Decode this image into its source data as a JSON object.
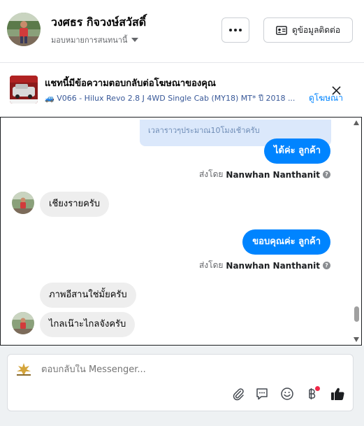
{
  "header": {
    "page_name": "วงศธร กิจวงษ์สวัสดิ์",
    "subtitle": "มอบหมายการสนทนานี้",
    "contact_button": "ดูข้อมูลติดต่อ"
  },
  "ad": {
    "title": "แชทนี้มีข้อความตอบกลับต่อโฆษณาของคุณ",
    "description": "🚙 V066 - Hilux Revo 2.8 J 4WD Single Cab (MY18) MT* ปี 2018 ...",
    "link": "ดูโฆษณา"
  },
  "chat": {
    "note": "เวลาราวๆประมาณ10โมงเช้าครับ",
    "messages": [
      {
        "direction": "out",
        "text": "ได้ค่ะ  ลูกค้า"
      },
      {
        "direction": "out",
        "sent_by_label": "ส่งโดย",
        "sent_by_name": "Nanwhan Nanthanit"
      },
      {
        "direction": "in",
        "text": "เชียงรายครับ"
      },
      {
        "direction": "out",
        "text": "ขอบคุณค่ะ  ลูกค้า"
      },
      {
        "direction": "out",
        "sent_by_label": "ส่งโดย",
        "sent_by_name": "Nanwhan Nanthanit"
      },
      {
        "direction": "in",
        "text": "ภาพอีสานใช่มั้ยครับ"
      },
      {
        "direction": "in",
        "text": "ไกลเน๊าะไกลจังครับ"
      }
    ]
  },
  "composer": {
    "placeholder": "ตอบกลับใน Messenger..."
  },
  "icons": {
    "attach": "paperclip-icon",
    "saved_replies": "chat-bubble-icon",
    "emoji": "smiley-icon",
    "payment": "baht-icon",
    "like": "thumbs-up-icon"
  },
  "colors": {
    "accent": "#0084ff",
    "incoming_bubble": "#eeeeee",
    "note_bubble": "#dbe8fb"
  }
}
